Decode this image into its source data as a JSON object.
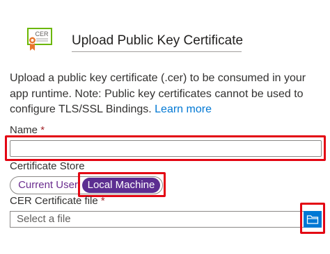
{
  "header": {
    "icon": "certificate-icon",
    "icon_badge": "CER",
    "title": "Upload Public Key Certificate"
  },
  "description": {
    "text": "Upload a public key certificate (.cer) to be consumed in your app runtime. Note: Public key certificates cannot be used to configure TLS/SSL Bindings.",
    "link_text": "Learn more"
  },
  "name_field": {
    "label": "Name",
    "required_mark": "*",
    "value": ""
  },
  "certificate_store": {
    "label": "Certificate Store",
    "options": [
      "Current User",
      "Local Machine"
    ],
    "selected": "Local Machine"
  },
  "cer_file": {
    "label": "CER Certificate file",
    "required_mark": "*",
    "placeholder": "Select a file",
    "browse_icon": "folder-icon"
  },
  "colors": {
    "highlight": "#e30613",
    "toggle_selected": "#5c2e91",
    "link": "#0078d4",
    "browse_button": "#0078d4",
    "certificate_green": "#6bb700",
    "ribbon_orange": "#e8772e"
  }
}
